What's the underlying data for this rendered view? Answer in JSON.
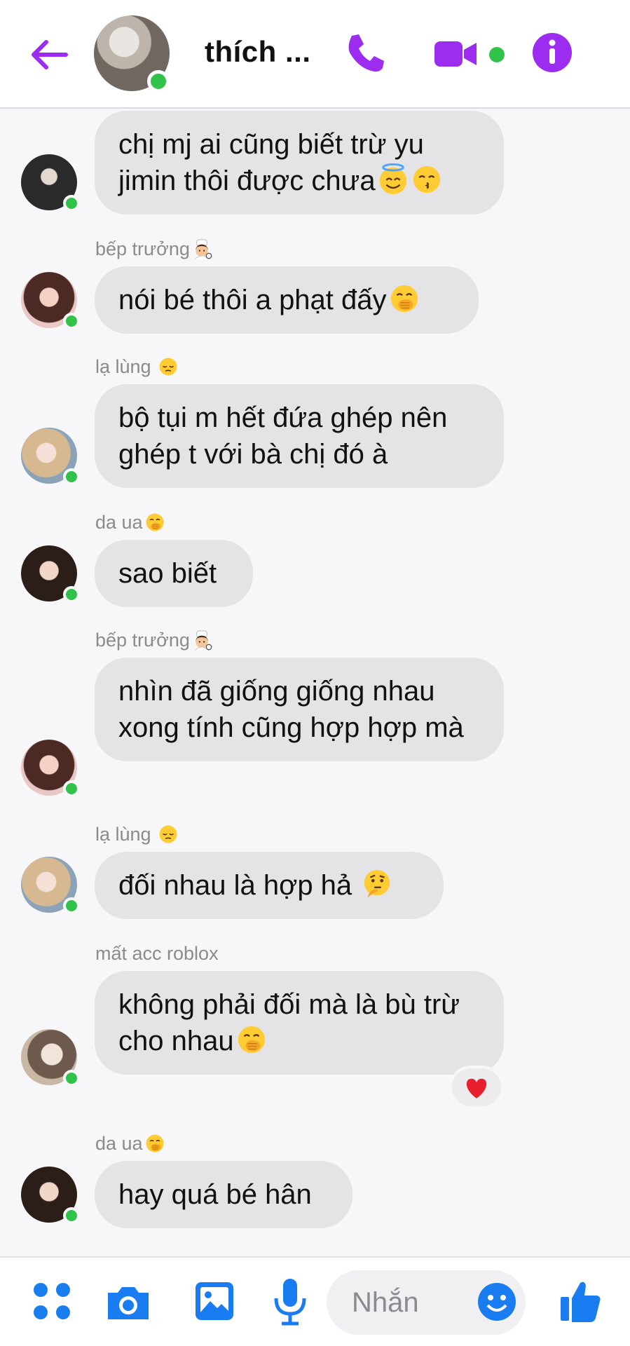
{
  "colors": {
    "accent": "#9b2cf0",
    "online": "#31c24a",
    "bubble": "#e4e4e6",
    "composer_icons": "#1a7cf1"
  },
  "header": {
    "title": "thích ...",
    "back_icon": "arrow-left-icon",
    "call_icon": "phone-icon",
    "video_icon": "video-camera-icon",
    "info_icon": "info-icon"
  },
  "messages": [
    {
      "sender": "",
      "text": "chị mj ai cũng biết trừ yu jimin thôi được chưa",
      "emojis": [
        "smiling-face-with-halo",
        "kissing-face-with-closed-eyes"
      ]
    },
    {
      "sender": "bếp trưởng",
      "sender_emoji": "cook",
      "text": "nói bé thôi a phạt đấy",
      "emojis": [
        "face-with-hand-over-mouth"
      ]
    },
    {
      "sender": "lạ lùng",
      "sender_emoji": "pensive-face",
      "text": "bộ tụi m hết đứa ghép nên ghép t với bà chị đó à"
    },
    {
      "sender": "da ua",
      "sender_emoji": "face-with-hand-over-mouth",
      "text": "sao biết"
    },
    {
      "sender": "bếp trưởng",
      "sender_emoji": "cook",
      "text": "nhìn đã giống giống nhau xong tính cũng hợp hợp mà"
    },
    {
      "sender": "lạ lùng",
      "sender_emoji": "pensive-face",
      "text": "đối nhau là hợp hả",
      "emojis": [
        "thinking-face"
      ]
    },
    {
      "sender": "mất acc roblox",
      "text": "không phải đối mà là bù trừ cho nhau",
      "emojis": [
        "face-with-hand-over-mouth"
      ],
      "reaction": "red-heart"
    },
    {
      "sender": "da ua",
      "sender_emoji": "face-with-hand-over-mouth",
      "text": "hay quá bé hân"
    }
  ],
  "composer": {
    "placeholder": "Nhắn",
    "menu_icon": "four-dots-menu-icon",
    "camera_icon": "camera-icon",
    "gallery_icon": "image-gallery-icon",
    "mic_icon": "microphone-icon",
    "emoji_icon": "smiley-icon",
    "like_icon": "thumbs-up-icon"
  }
}
